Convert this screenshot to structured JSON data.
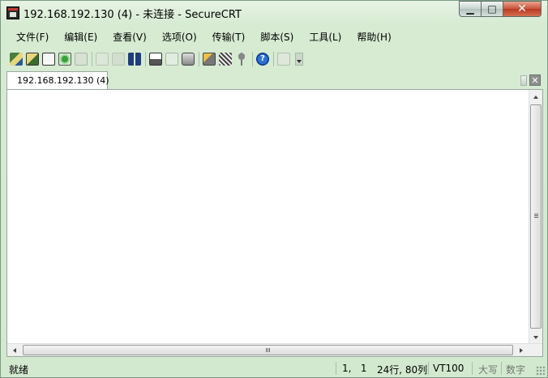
{
  "window": {
    "title": "192.168.192.130 (4) - 未连接 - SecureCRT",
    "minimize_label": "▁",
    "maximize_label": "□",
    "close_label": "✕"
  },
  "menu": [
    {
      "label": "文件(F)"
    },
    {
      "label": "编辑(E)"
    },
    {
      "label": "查看(V)"
    },
    {
      "label": "选项(O)"
    },
    {
      "label": "传输(T)"
    },
    {
      "label": "脚本(S)"
    },
    {
      "label": "工具(L)"
    },
    {
      "label": "帮助(H)"
    }
  ],
  "toolbar": {
    "icons": [
      "connect-icon",
      "quick-connect-icon",
      "connect-in-tab-icon",
      "reconnect-icon",
      "disconnect-icon",
      "copy-icon",
      "paste-icon",
      "find-icon",
      "print-screen-icon",
      "print-selection-icon",
      "print-icon",
      "session-options-icon",
      "global-options-icon",
      "key-generator-icon",
      "help-icon",
      "keymap-icon"
    ],
    "help_glyph": "?"
  },
  "tabs": [
    {
      "label": "192.168.192.130 (4)",
      "status_color": "#dd1111"
    }
  ],
  "tab_close_label": "✕",
  "status": {
    "ready": "就绪",
    "cursor": "1,   1",
    "size": "24行, 80列",
    "terminal": "VT100",
    "caps": "大写",
    "num": "数字"
  },
  "colors": {
    "window_bg": "#d3e9cf",
    "terminal_bg": "#ffffff",
    "close_button": "#c9533a"
  }
}
